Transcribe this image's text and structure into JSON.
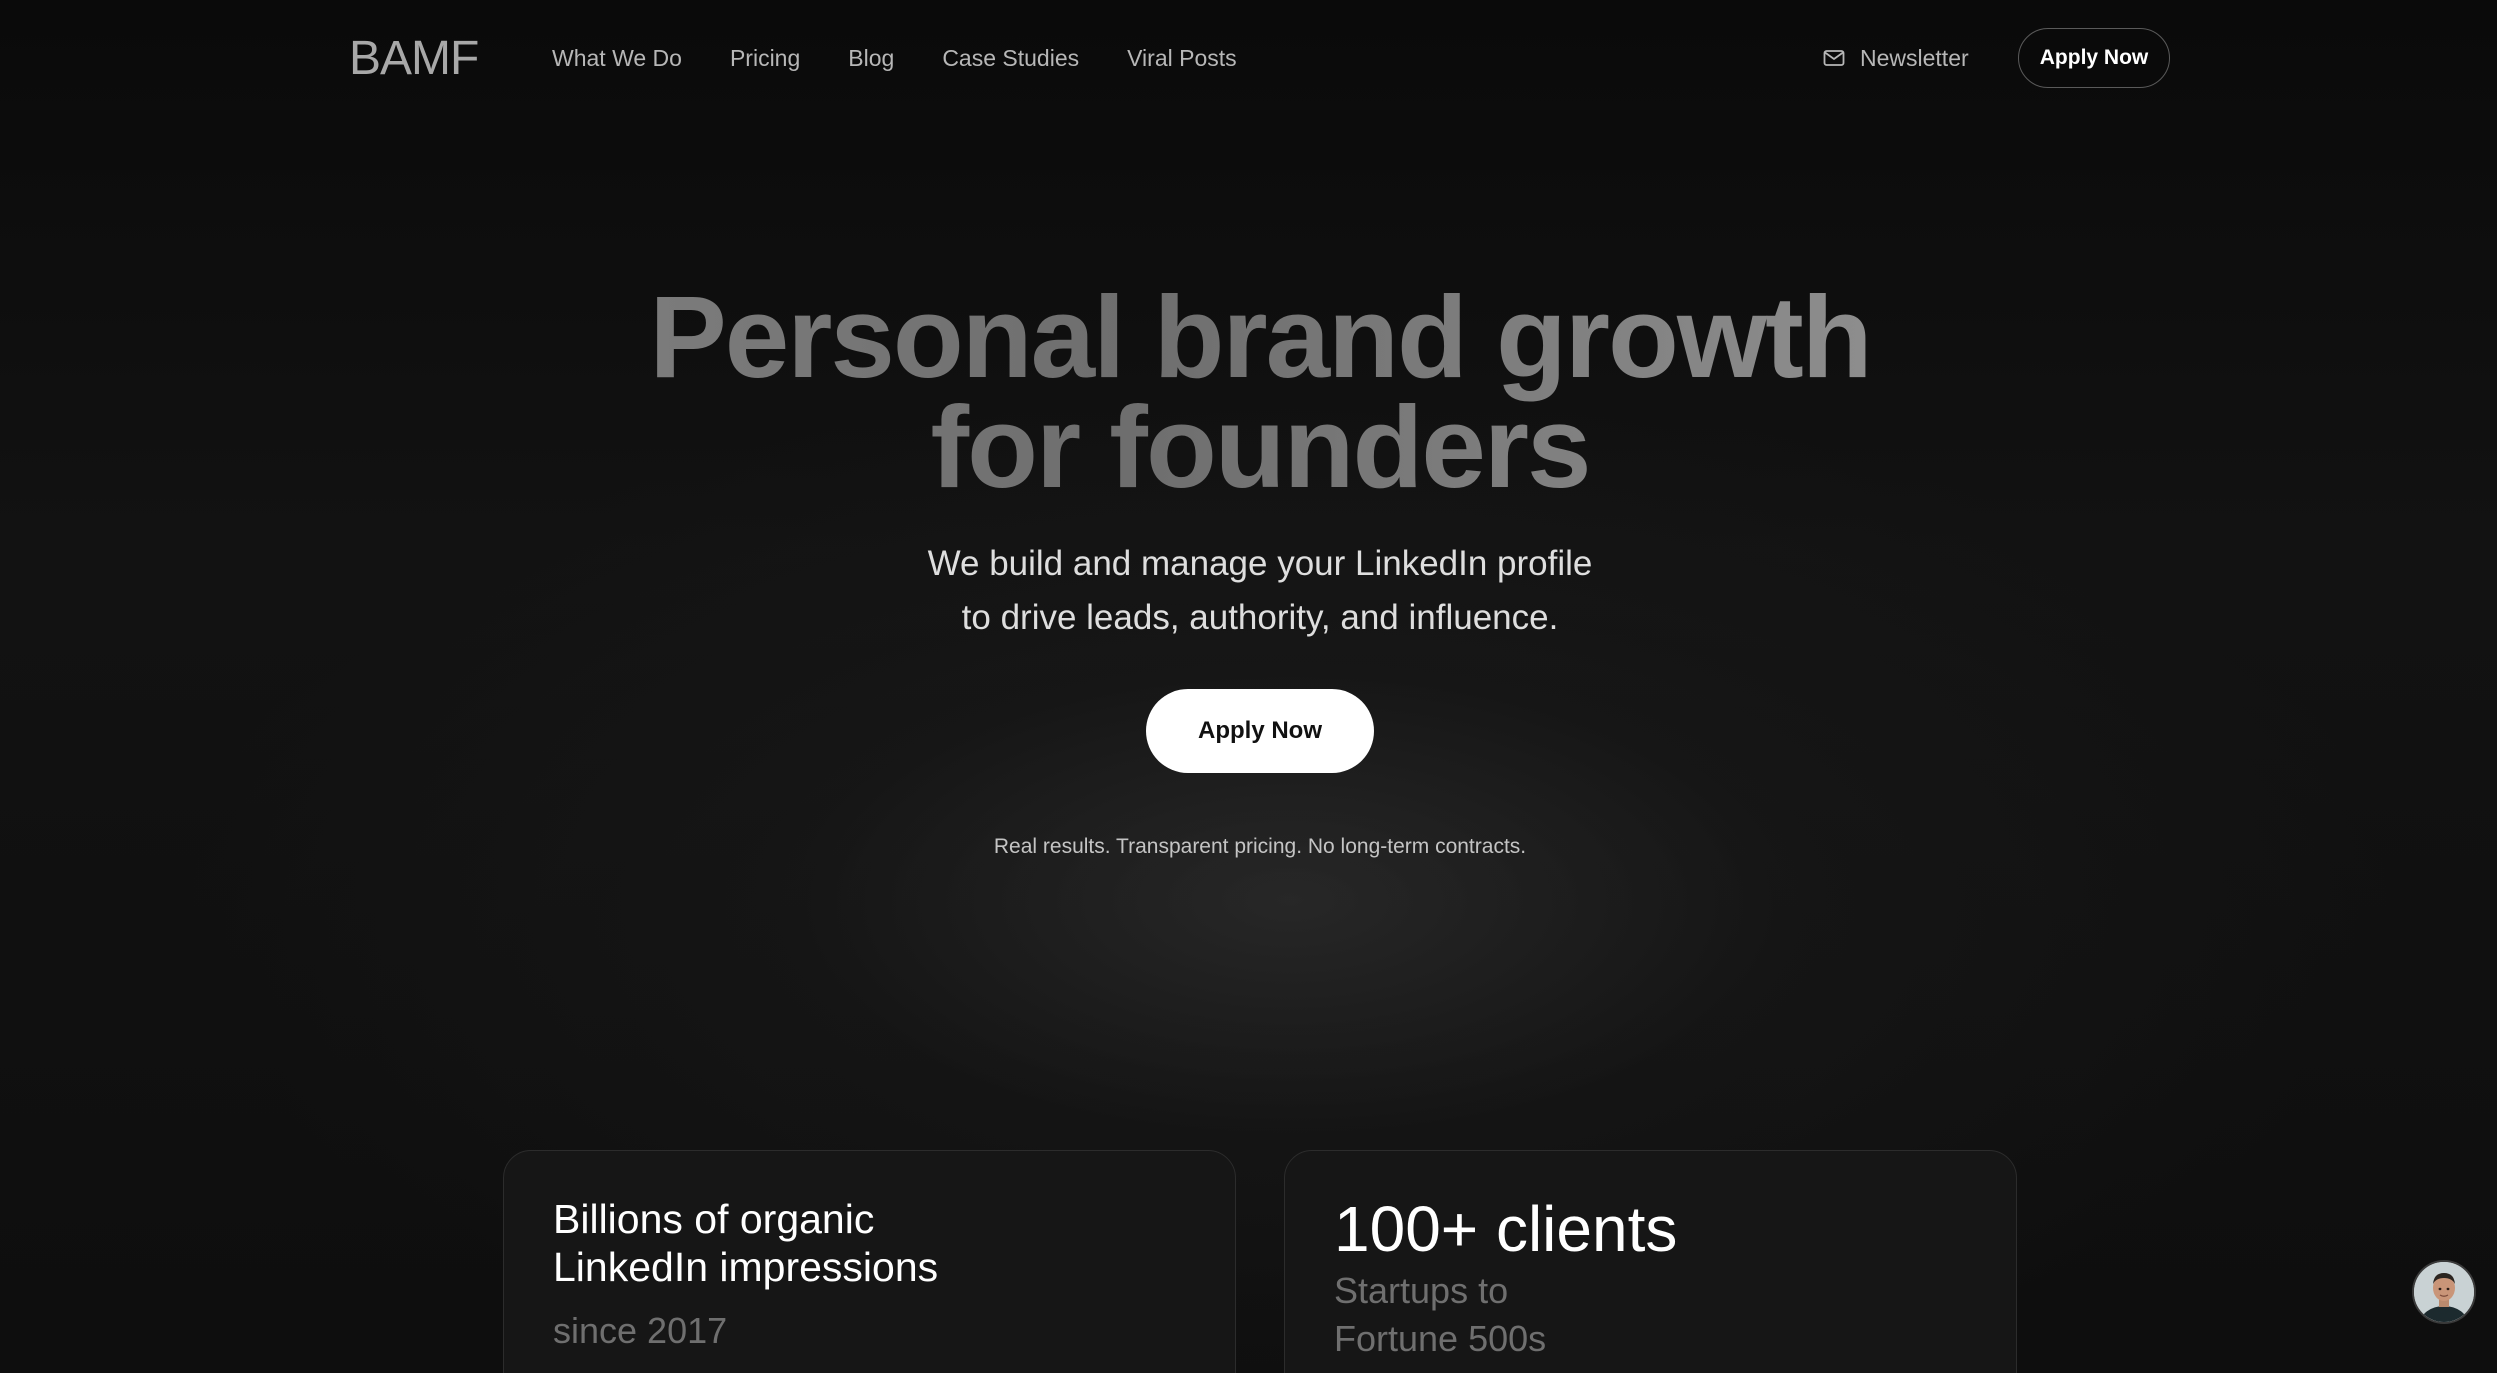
{
  "brand": {
    "logo": "BAMF"
  },
  "nav": {
    "links": [
      "What We Do",
      "Pricing",
      "Blog",
      "Case Studies",
      "Viral Posts"
    ],
    "newsletter": {
      "label": "Newsletter",
      "icon": "mail-icon"
    },
    "apply_label": "Apply Now"
  },
  "hero": {
    "title_line1": "Personal brand growth",
    "title_line2": "for founders",
    "subtitle_line1": "We build and manage your LinkedIn profile",
    "subtitle_line2": "to drive leads, authority, and influence.",
    "cta_label": "Apply Now",
    "note": "Real results. Transparent pricing. No long-term contracts."
  },
  "stats": {
    "left": {
      "title_line1": "Billions of organic",
      "title_line2": "LinkedIn impressions",
      "sub": "since 2017"
    },
    "right": {
      "title": "100+ clients",
      "sub_line1": "Startups to",
      "sub_line2": "Fortune 500s"
    }
  },
  "chat_widget": {
    "icon": "avatar"
  },
  "colors": {
    "background": "#0b0b0b",
    "nav_text": "#b7b7b7",
    "cta_bg": "#ffffff",
    "cta_text": "#111111",
    "card_bg": "#161616",
    "muted_text": "#6f6f6f"
  }
}
